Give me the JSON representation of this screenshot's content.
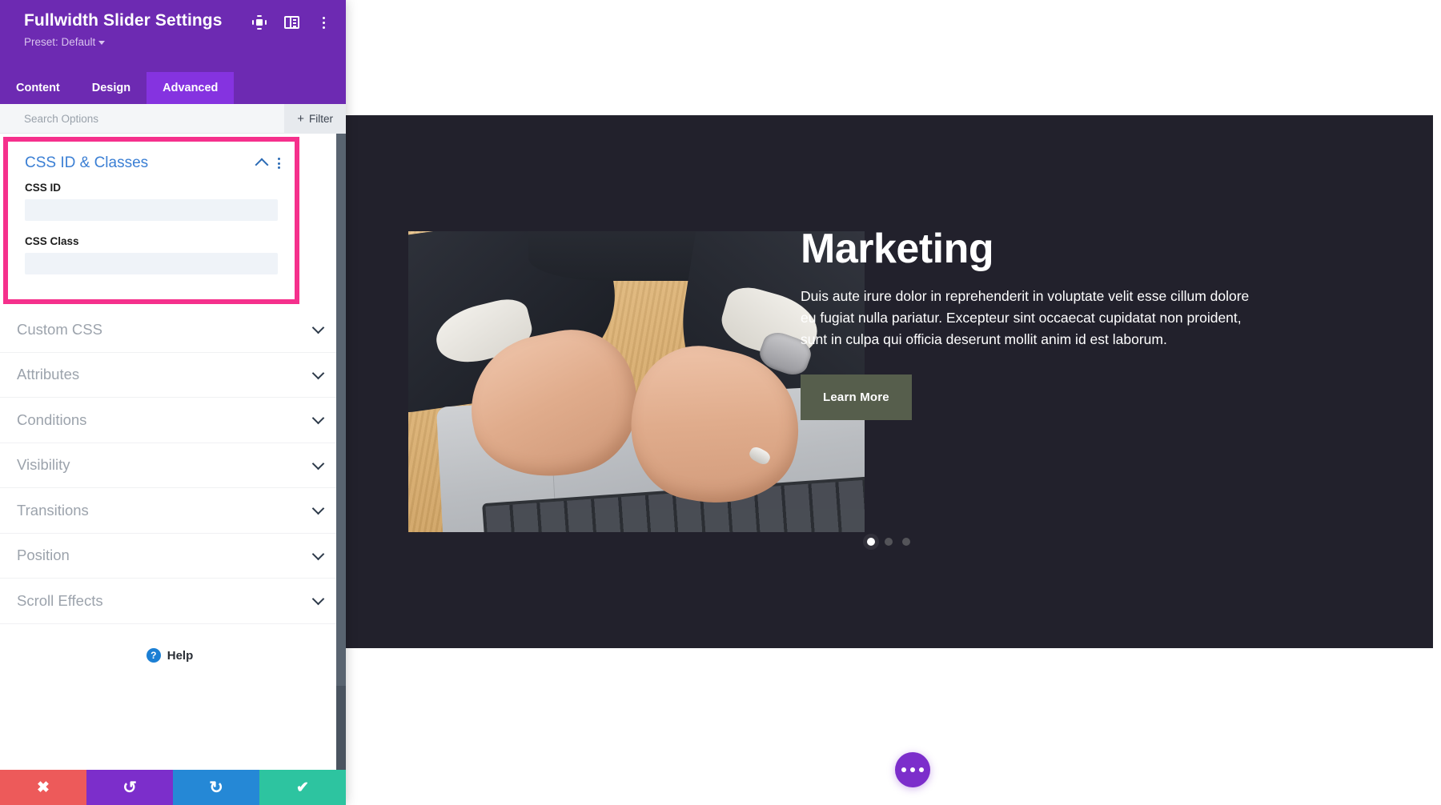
{
  "panel": {
    "title": "Fullwidth Slider Settings",
    "preset": "Preset: Default",
    "header_icons": [
      {
        "name": "focus-icon",
        "label": "focus"
      },
      {
        "name": "panel-layout-icon",
        "label": "layout"
      },
      {
        "name": "kebab-menu-icon",
        "label": "more"
      }
    ],
    "tabs": [
      {
        "label": "Content",
        "active": false
      },
      {
        "label": "Design",
        "active": false
      },
      {
        "label": "Advanced",
        "active": true
      }
    ],
    "search": {
      "placeholder": "Search Options",
      "value": "",
      "filter_label": "Filter",
      "filter_plus": "+"
    },
    "open_section": {
      "title": "CSS ID & Classes",
      "fields": [
        {
          "label": "CSS ID",
          "value": "",
          "placeholder": ""
        },
        {
          "label": "CSS Class",
          "value": "",
          "placeholder": ""
        }
      ]
    },
    "sections": [
      {
        "label": "Custom CSS"
      },
      {
        "label": "Attributes"
      },
      {
        "label": "Conditions"
      },
      {
        "label": "Visibility"
      },
      {
        "label": "Transitions"
      },
      {
        "label": "Position"
      },
      {
        "label": "Scroll Effects"
      }
    ],
    "help": {
      "label": "Help",
      "glyph": "?"
    },
    "footer_buttons": [
      {
        "name": "cancel-button",
        "glyph": "✖",
        "color": "#ed5a5a"
      },
      {
        "name": "undo-button",
        "glyph": "↺",
        "color": "#7c2ecb"
      },
      {
        "name": "redo-button",
        "glyph": "↻",
        "color": "#2588d6"
      },
      {
        "name": "save-button",
        "glyph": "✔",
        "color": "#2dc4a0"
      }
    ],
    "colors": {
      "header_purple": "#6d2ab2",
      "tab_active_purple": "#8533e0",
      "highlight_pink": "#f5308c",
      "section_title_blue": "#3b7fd4"
    }
  },
  "slide": {
    "title": "Marketing",
    "description": "Duis aute irure dolor in reprehenderit in voluptate velit esse cillum dolore eu fugiat nulla pariatur. Excepteur sint occaecat cupidatat non proident, sunt in culpa qui officia deserunt mollit anim id est laborum.",
    "button_label": "Learn More",
    "background_color": "#22212c",
    "button_color": "#565e4c",
    "dots": [
      {
        "active": true
      },
      {
        "active": false
      },
      {
        "active": false
      }
    ],
    "image_alt": "hands typing on a laptop at a wooden desk"
  },
  "floating_action": {
    "name": "page-settings-fab",
    "color": "#7c2ecb",
    "dots": 3
  }
}
